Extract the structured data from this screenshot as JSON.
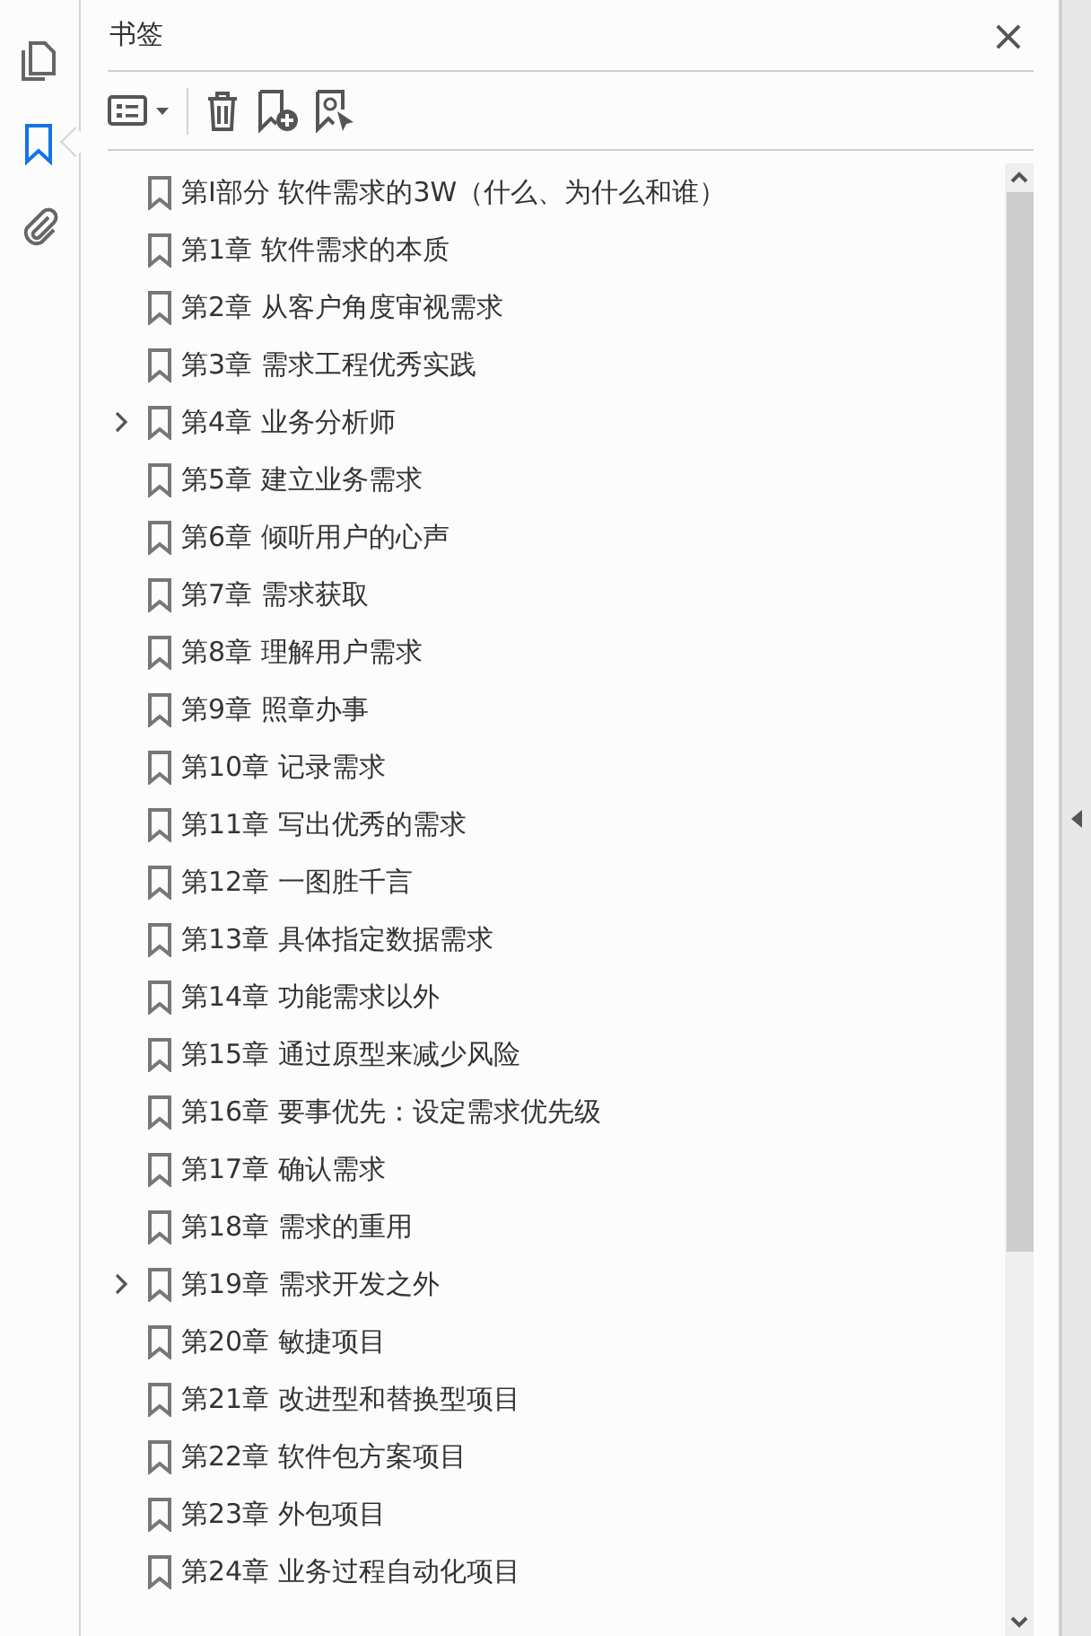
{
  "rail": [
    {
      "kind": "pages",
      "selected": false
    },
    {
      "kind": "bookmarks",
      "selected": true
    },
    {
      "kind": "attachments",
      "selected": false
    }
  ],
  "panel": {
    "title": "书签",
    "close": "×"
  },
  "bookmarks": [
    {
      "label": "第Ⅰ部分  软件需求的3W（什么、为什么和谁）",
      "has_children": false
    },
    {
      "label": "第1章  软件需求的本质",
      "has_children": false
    },
    {
      "label": "第2章  从客户角度审视需求",
      "has_children": false
    },
    {
      "label": "第3章  需求工程优秀实践",
      "has_children": false
    },
    {
      "label": "第4章  业务分析师",
      "has_children": true
    },
    {
      "label": "第5章  建立业务需求",
      "has_children": false
    },
    {
      "label": "第6章  倾听用户的心声",
      "has_children": false
    },
    {
      "label": "第7章  需求获取",
      "has_children": false
    },
    {
      "label": "第8章  理解用户需求",
      "has_children": false
    },
    {
      "label": "第9章  照章办事",
      "has_children": false
    },
    {
      "label": "第10章  记录需求",
      "has_children": false
    },
    {
      "label": "第11章  写出优秀的需求",
      "has_children": false
    },
    {
      "label": "第12章  一图胜千言",
      "has_children": false
    },
    {
      "label": "第13章  具体指定数据需求",
      "has_children": false
    },
    {
      "label": "第14章  功能需求以外",
      "has_children": false
    },
    {
      "label": "第15章  通过原型来减少风险",
      "has_children": false
    },
    {
      "label": "第16章  要事优先：设定需求优先级",
      "has_children": false
    },
    {
      "label": "第17章  确认需求",
      "has_children": false
    },
    {
      "label": "第18章  需求的重用",
      "has_children": false
    },
    {
      "label": "第19章  需求开发之外",
      "has_children": true
    },
    {
      "label": "第20章  敏捷项目",
      "has_children": false
    },
    {
      "label": "第21章  改进型和替换型项目",
      "has_children": false
    },
    {
      "label": "第22章  软件包方案项目",
      "has_children": false
    },
    {
      "label": "第23章  外包项目",
      "has_children": false
    },
    {
      "label": "第24章  业务过程自动化项目",
      "has_children": false
    }
  ]
}
